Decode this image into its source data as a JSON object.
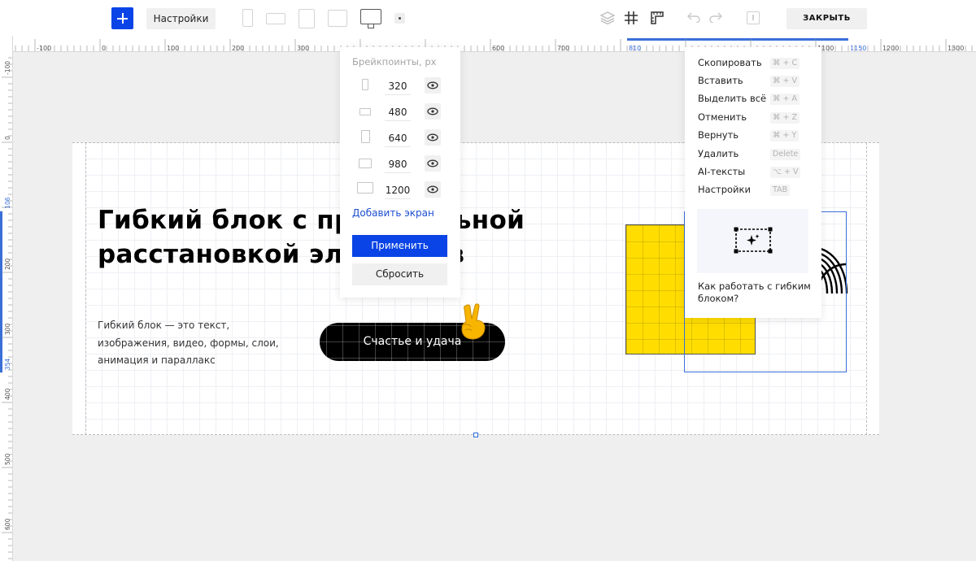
{
  "toolbar": {
    "add_icon": "plus-icon",
    "settings_label": "Настройки",
    "device_icons": [
      "phone-icon",
      "phone-landscape-icon",
      "tablet-icon",
      "tablet-landscape-icon",
      "desktop-icon"
    ],
    "close_label": "ЗАКРЫТЬ",
    "accent_color": "#0a44e6"
  },
  "ruler": {
    "top_labels": [
      "-100",
      "0",
      "100",
      "200",
      "300",
      "600",
      "700",
      "810",
      "1100",
      "1150",
      "1200",
      "1300"
    ],
    "left_labels": [
      "-100",
      "0",
      "106",
      "200",
      "300",
      "354",
      "400",
      "500",
      "600"
    ],
    "highlight_color": "#3a6fd8"
  },
  "canvas": {
    "headline": "Гибкий блок с произвольной расстановкой элементов",
    "description": "Гибкий блок — это текст, изображения, видео, формы, слои, анимация и параллакс",
    "button_label": "Счастье и удача",
    "shape_color": "#ffdd00"
  },
  "breakpoints": {
    "title": "Брейкпоинты, px",
    "items": [
      {
        "icon": "phone-icon",
        "value": "320"
      },
      {
        "icon": "phone-landscape-icon",
        "value": "480"
      },
      {
        "icon": "tablet-icon",
        "value": "640"
      },
      {
        "icon": "tablet-landscape-icon",
        "value": "980"
      },
      {
        "icon": "desktop-icon",
        "value": "1200"
      }
    ],
    "add_label": "Добавить экран",
    "apply_label": "Применить",
    "reset_label": "Сбросить"
  },
  "context_menu": {
    "items": [
      {
        "label": "Скопировать",
        "shortcut": "⌘ + C"
      },
      {
        "label": "Вставить",
        "shortcut": "⌘ + V"
      },
      {
        "label": "Выделить всё",
        "shortcut": "⌘ + A"
      },
      {
        "label": "Отменить",
        "shortcut": "⌘ + Z"
      },
      {
        "label": "Вернуть",
        "shortcut": "⌘ + Y"
      },
      {
        "label": "Удалить",
        "shortcut": "Delete"
      },
      {
        "label": "AI-тексты",
        "shortcut": "⌥ + V"
      },
      {
        "label": "Настройки",
        "shortcut": "TAB"
      }
    ],
    "help_label": "Как работать с гибким блоком?"
  }
}
